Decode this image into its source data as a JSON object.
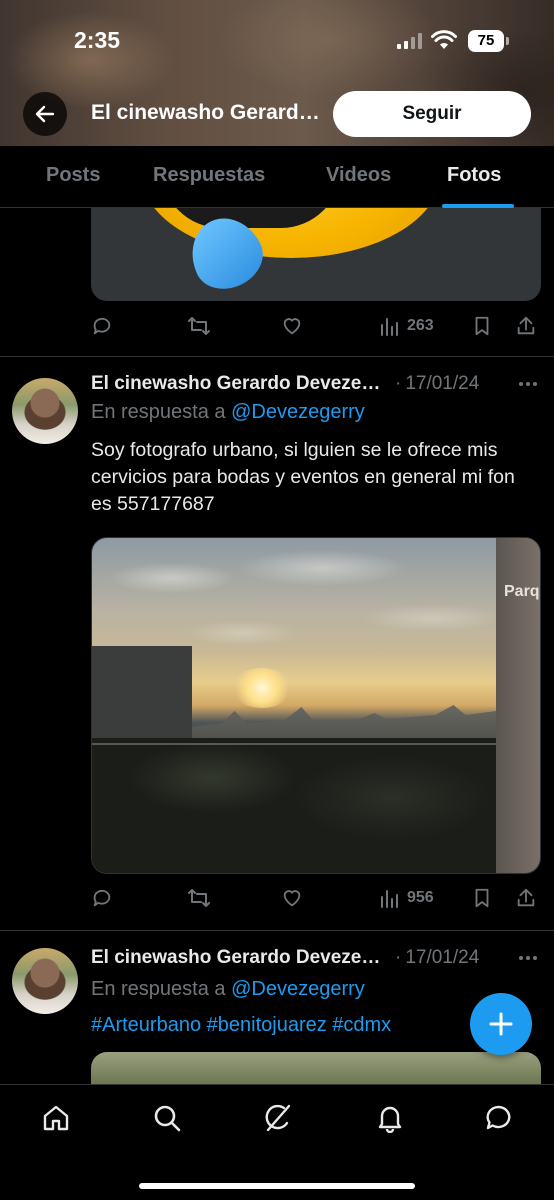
{
  "status_bar": {
    "time": "2:35",
    "battery": "75"
  },
  "header": {
    "title": "El cinewasho Gerardo Devezegerry",
    "follow_label": "Seguir"
  },
  "tabs": [
    {
      "label": "Posts",
      "active": false
    },
    {
      "label": "Respuestas",
      "active": false
    },
    {
      "label": "Videos",
      "active": false
    },
    {
      "label": "Fotos",
      "active": true
    }
  ],
  "posts": [
    {
      "views": "263"
    },
    {
      "author": "El cinewasho Gerardo Devezegerry",
      "date": "17/01/24",
      "reply_prefix": "En respuesta a",
      "reply_to": "@Devezegerry",
      "text": "Soy fotografo urbano, si lguien se le ofrece mis cervicios para bodas y eventos en general mi fon es 557177687",
      "photo_sign": "Parqu",
      "views": "956"
    },
    {
      "author": "El cinewasho Gerardo Devezegerry",
      "date": "17/01/24",
      "reply_prefix": "En respuesta a",
      "reply_to": "@Devezegerry",
      "hashtags": "#Arteurbano #benitojuarez #cdmx"
    }
  ],
  "colors": {
    "accent": "#1d9bf0",
    "background": "#000000",
    "muted": "#71767b",
    "text": "#e7e9ea"
  },
  "icons": {
    "back": "arrow-left-icon",
    "reply": "reply-icon",
    "repost": "repost-icon",
    "like": "heart-icon",
    "views": "views-icon",
    "bookmark": "bookmark-icon",
    "share": "share-icon",
    "more": "more-icon",
    "compose": "plus-icon",
    "home": "home-icon",
    "search": "search-icon",
    "grok": "grok-icon",
    "notifications": "bell-icon",
    "messages": "message-icon"
  }
}
